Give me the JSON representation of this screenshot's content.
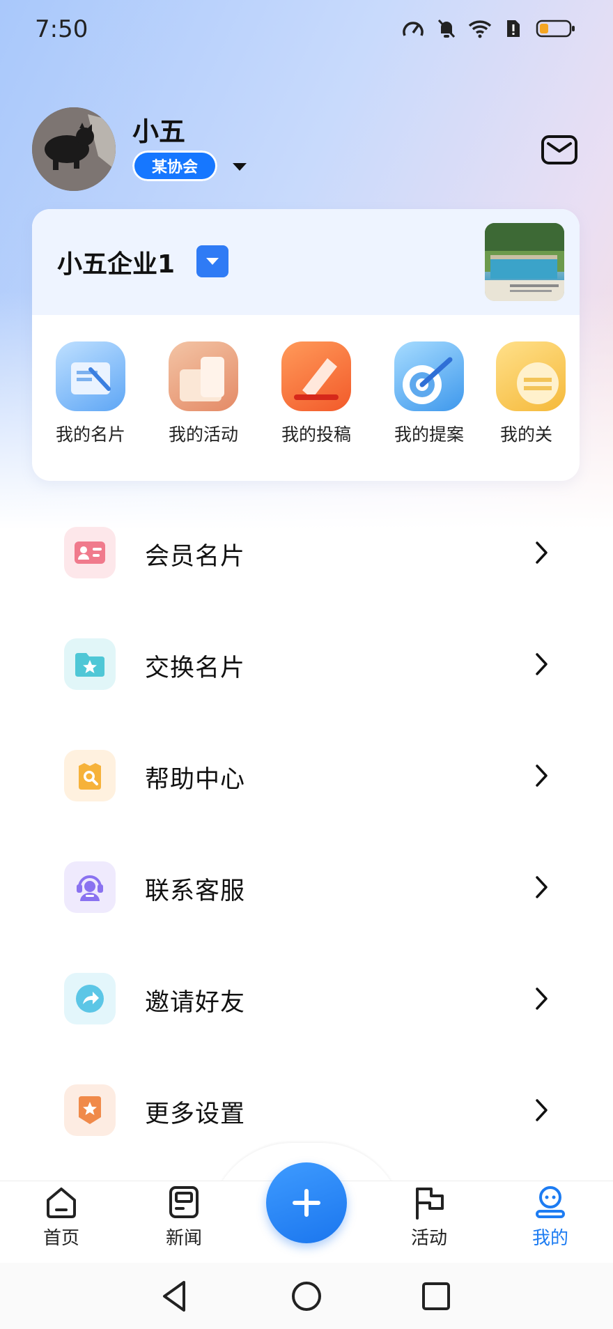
{
  "status_bar": {
    "time": "7:50"
  },
  "profile": {
    "name": "小五",
    "association": "某协会"
  },
  "enterprise": {
    "name": "小五企业1"
  },
  "quick_actions": [
    {
      "label": "我的名片",
      "icon": "business-card-icon"
    },
    {
      "label": "我的活动",
      "icon": "activity-icon"
    },
    {
      "label": "我的投稿",
      "icon": "pen-icon"
    },
    {
      "label": "我的提案",
      "icon": "target-icon"
    },
    {
      "label": "我的关",
      "icon": "folder-icon"
    }
  ],
  "menu": [
    {
      "label": "会员名片",
      "icon": "member-card-icon",
      "color": "#f07a8c"
    },
    {
      "label": "交换名片",
      "icon": "folder-star-icon",
      "color": "#4fc7d6"
    },
    {
      "label": "帮助中心",
      "icon": "help-search-icon",
      "color": "#f6b23a"
    },
    {
      "label": "联系客服",
      "icon": "customer-service-icon",
      "color": "#8a72f0"
    },
    {
      "label": "邀请好友",
      "icon": "share-arrow-icon",
      "color": "#5cc6e6"
    },
    {
      "label": "更多设置",
      "icon": "settings-badge-icon",
      "color": "#f08a4a"
    }
  ],
  "tabbar": {
    "home": "首页",
    "news": "新闻",
    "activity": "活动",
    "mine": "我的",
    "accent": "#1d7cf2"
  }
}
